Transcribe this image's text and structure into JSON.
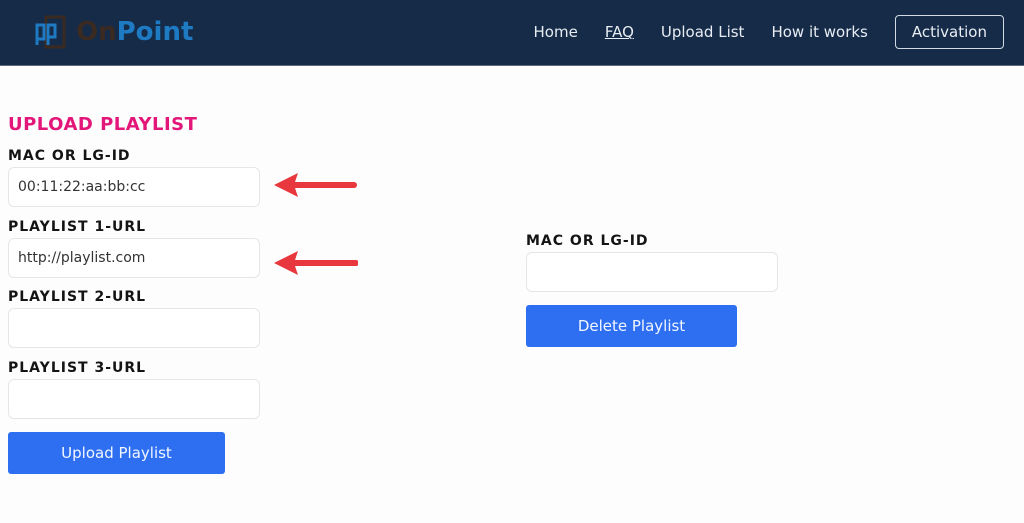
{
  "header": {
    "logo": {
      "part1": "On",
      "part2": "Point"
    },
    "nav": [
      {
        "label": "Home"
      },
      {
        "label": "FAQ"
      },
      {
        "label": "Upload List"
      },
      {
        "label": "How it works"
      }
    ],
    "activation_label": "Activation"
  },
  "upload": {
    "title": "UPLOAD PLAYLIST",
    "mac_label": "MAC OR LG-ID",
    "mac_value": "00:11:22:aa:bb:cc",
    "playlist1_label": "PLAYLIST 1-URL",
    "playlist1_value": "http://playlist.com",
    "playlist2_label": "PLAYLIST 2-URL",
    "playlist2_value": "",
    "playlist3_label": "PLAYLIST 3-URL",
    "playlist3_value": "",
    "submit_label": "Upload Playlist"
  },
  "delete": {
    "mac_label": "MAC OR LG-ID",
    "mac_value": "",
    "submit_label": "Delete Playlist"
  },
  "annotations": {
    "arrow_color": "#e8383d"
  },
  "colors": {
    "header_bg": "#152b48",
    "title": "#e3177a",
    "button": "#2e6ff2",
    "logo_point": "#1f7ac4"
  }
}
